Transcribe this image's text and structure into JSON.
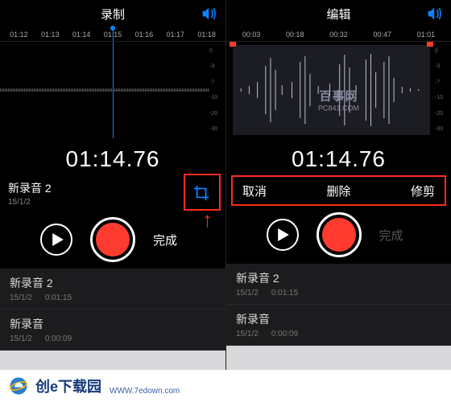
{
  "left": {
    "title": "录制",
    "ruler": [
      "01:12",
      "01:13",
      "01:14",
      "01:15",
      "01:16",
      "01:17",
      "01:18"
    ],
    "db_scale": [
      "0",
      "-3",
      "-7",
      "-10",
      "-20",
      "-30"
    ],
    "time": "01:14.76",
    "clip_name": "新录音 2",
    "clip_date": "15/1/2",
    "done_label": "完成",
    "list": [
      {
        "title": "新录音 2",
        "date": "15/1/2",
        "duration": "0:01:15"
      },
      {
        "title": "新录音",
        "date": "15/1/2",
        "duration": "0:00:09"
      }
    ]
  },
  "right": {
    "title": "编辑",
    "ruler": [
      "00:03",
      "00:18",
      "00:32",
      "00:47",
      "01:01"
    ],
    "db_scale": [
      "0",
      "-3",
      "-7",
      "-10",
      "-20",
      "-30"
    ],
    "time": "01:14.76",
    "actions": {
      "cancel": "取消",
      "delete": "删除",
      "trim": "修剪"
    },
    "done_label": "完成",
    "watermark_big": "百事网",
    "watermark_small": "PC841.COM",
    "list": [
      {
        "title": "新录音 2",
        "date": "15/1/2",
        "duration": "0:01:15"
      },
      {
        "title": "新录音",
        "date": "15/1/2",
        "duration": "0:00:09"
      }
    ]
  },
  "footer": {
    "brand": "创e下载园",
    "url": "WWW.7edown.com"
  }
}
